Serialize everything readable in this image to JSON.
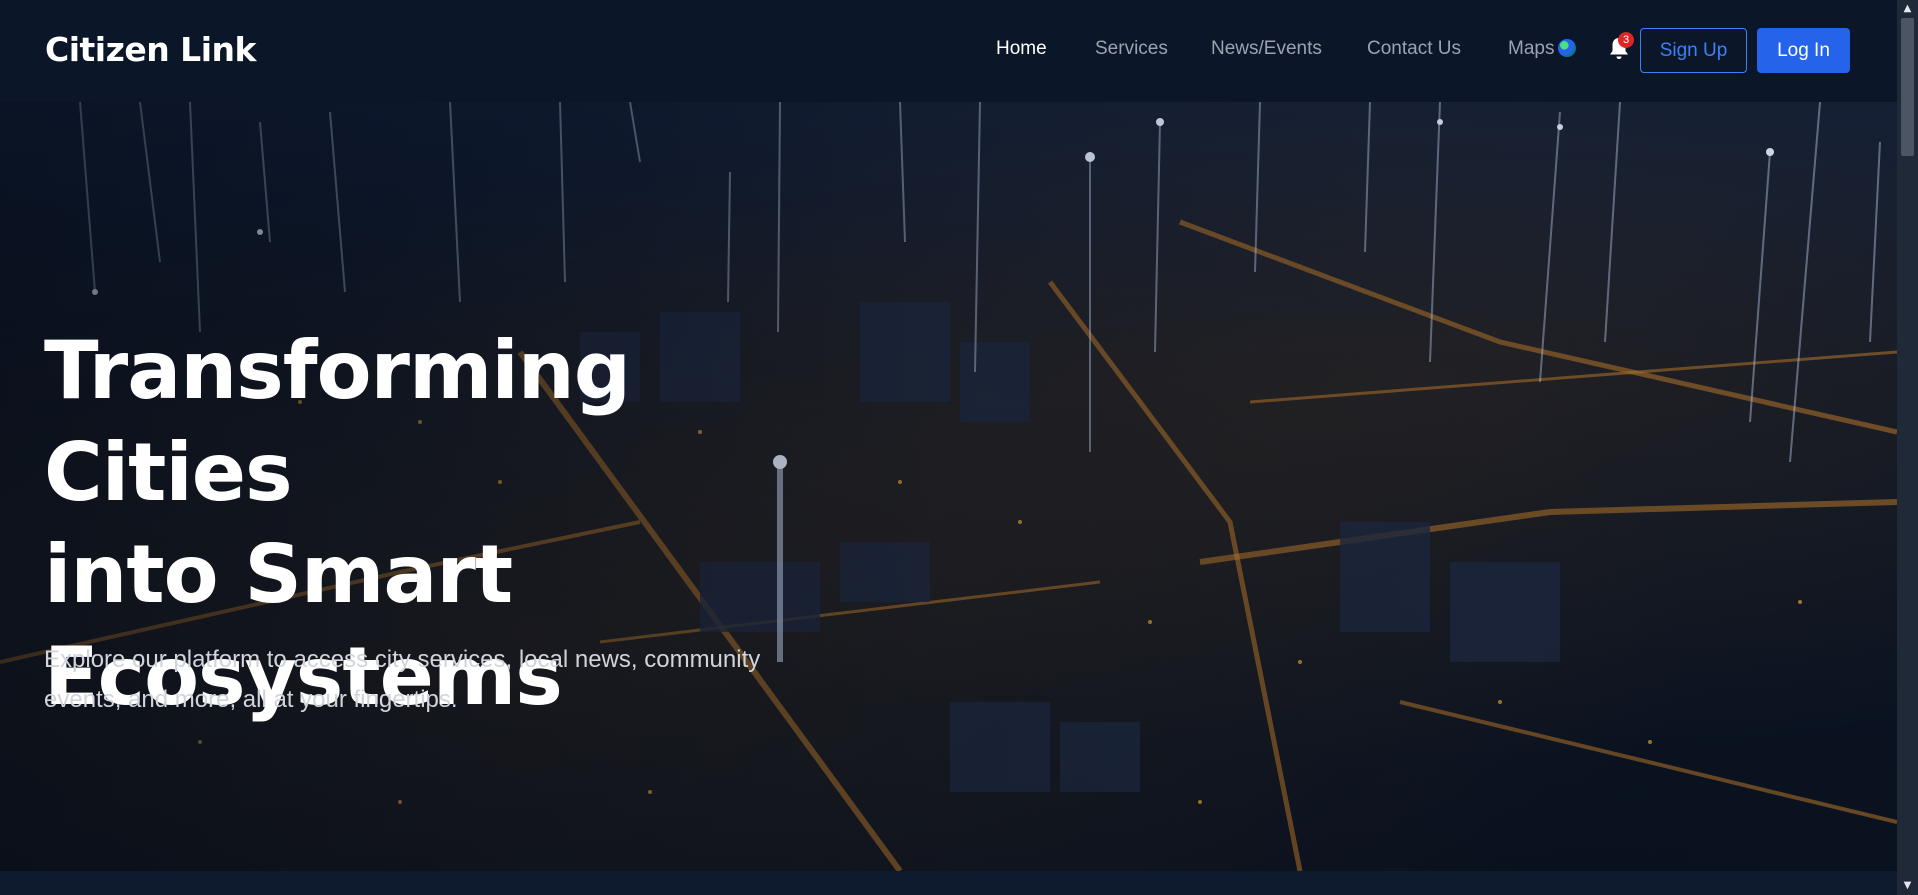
{
  "header": {
    "brand": "Citizen Link",
    "nav": [
      {
        "label": "Home",
        "active": true
      },
      {
        "label": "Services",
        "active": false
      },
      {
        "label": "News/Events",
        "active": false
      },
      {
        "label": "Contact Us",
        "active": false
      },
      {
        "label": "Maps",
        "active": false
      }
    ],
    "notifications": {
      "icon": "bell-icon",
      "count": "3"
    },
    "signup_label": "Sign Up",
    "login_label": "Log In"
  },
  "hero": {
    "title_lines": [
      "Transforming Cities",
      "into Smart",
      "Ecosystems"
    ],
    "subtitle_lines": [
      "Explore our platform to access city services, local news, community",
      "events, and more, all at your fingertips."
    ]
  },
  "colors": {
    "navbar_bg": "#0b1628",
    "accent": "#2563eb",
    "badge": "#dc2626",
    "text_muted": "#9ca3af"
  }
}
